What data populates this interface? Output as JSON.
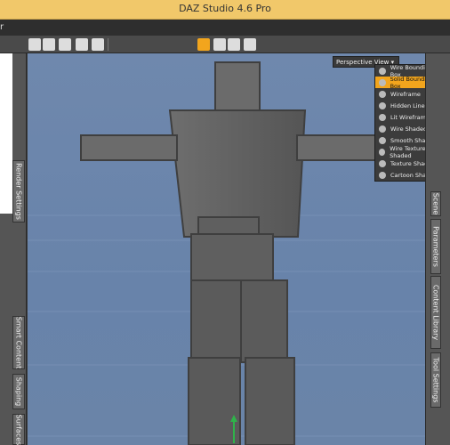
{
  "window": {
    "title": "DAZ Studio 4.6 Pro",
    "menu_stub": "r"
  },
  "viewport": {
    "view_dropdown": "Perspective View",
    "draw_style_options": [
      {
        "label": "Wire Bounding Box",
        "selected": false
      },
      {
        "label": "Solid Bounding Box",
        "selected": true
      },
      {
        "label": "Wireframe",
        "selected": false
      },
      {
        "label": "Hidden Line",
        "selected": false
      },
      {
        "label": "Lit Wireframe",
        "selected": false
      },
      {
        "label": "Wire Shaded",
        "selected": false
      },
      {
        "label": "Smooth Shaded",
        "selected": false
      },
      {
        "label": "Wire Texture Shaded",
        "selected": false
      },
      {
        "label": "Texture Shaded",
        "selected": false
      },
      {
        "label": "Cartoon Shaded",
        "selected": false
      }
    ]
  },
  "left_tabs": [
    "Render Settings",
    "Smart Content",
    "Shaping",
    "Surfaces"
  ],
  "right_tabs": [
    "Scene",
    "Parameters",
    "Content Library",
    "Tool Settings"
  ],
  "colors": {
    "accent": "#f2a51d",
    "viewport_bg": "#6f88ad",
    "titlebar": "#f1c86a"
  }
}
